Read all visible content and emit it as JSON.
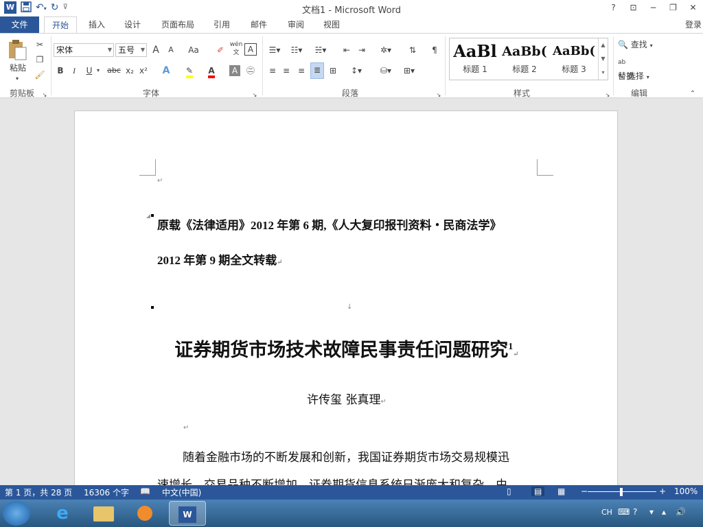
{
  "app": {
    "title": "文档1 - Microsoft Word"
  },
  "qat": {
    "word_icon": "W",
    "save_icon": "save-icon",
    "undo_icon": "undo-icon",
    "redo_icon": "redo-icon"
  },
  "window": {
    "help": "?",
    "restore_ribbon": "⊡",
    "minimize": "−",
    "maximize": "❐",
    "close": "✕"
  },
  "tabs": [
    "文件",
    "开始",
    "插入",
    "设计",
    "页面布局",
    "引用",
    "邮件",
    "审阅",
    "视图"
  ],
  "login": "登录",
  "ribbon": {
    "clipboard": {
      "paste": "粘贴",
      "label": "剪贴板"
    },
    "font": {
      "name": "宋体",
      "size": "五号",
      "label": "字体",
      "bold": "B",
      "italic": "I",
      "underline": "U",
      "strike": "abc",
      "sub": "x₂",
      "sup": "x²",
      "grow": "A",
      "shrink": "A",
      "case": "Aa",
      "phonetic": "wén 文",
      "border_char": "A"
    },
    "paragraph": {
      "label": "段落"
    },
    "styles": {
      "label": "样式",
      "items": [
        {
          "preview": "AaBl",
          "name": "标题 1"
        },
        {
          "preview": "AaBb(",
          "name": "标题 2"
        },
        {
          "preview": "AaBb(",
          "name": "标题 3"
        }
      ]
    },
    "editing": {
      "label": "编辑",
      "find": "查找",
      "replace": "替换",
      "select": "选择"
    }
  },
  "document": {
    "source_line1": "原载《法律适用》2012 年第 6 期,《人大复印报刊资料・民商法学》",
    "source_line2": "2012 年第 9 期全文转载",
    "title": "证券期货市场技术故障民事责任问题研究",
    "title_note": "1",
    "authors": "许传玺  张真理",
    "body_line1": "随着金融市场的不断发展和创新，我国证券期货市场交易规模迅",
    "body_line2": "速增长，交易品种不断增加，证券期货信息系统日渐庞大和复杂，由",
    "para_mark": "↵",
    "line_mark": "↓"
  },
  "statusbar": {
    "page": "第 1 页，共 28 页",
    "words": "16306 个字",
    "language": "中文(中国)",
    "zoom": "100%",
    "zoom_minus": "−",
    "zoom_plus": "+"
  },
  "taskbar": {
    "ime": "CH"
  },
  "colors": {
    "accent": "#2b579a",
    "highlight": "#ffff00",
    "font_color": "#ff0000"
  }
}
